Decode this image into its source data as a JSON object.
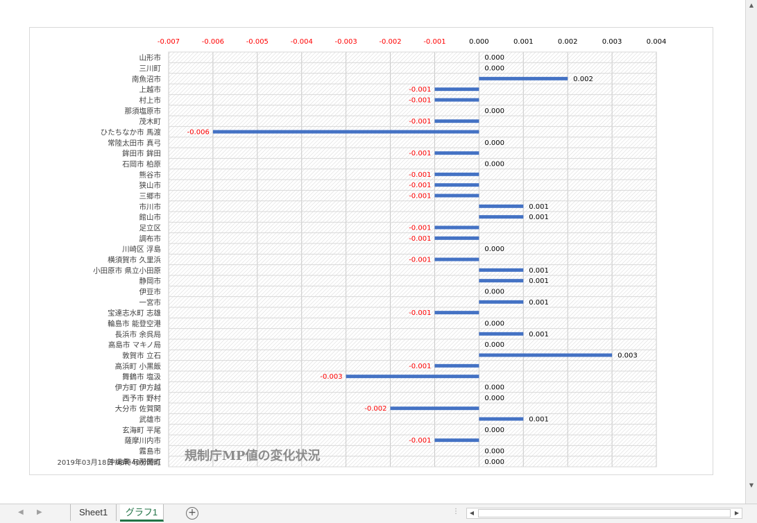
{
  "chart_data": {
    "type": "bar",
    "orientation": "horizontal",
    "title": "規制庁MP値の変化状況",
    "timestamp": "2019年03月18日 08時40分時点",
    "xlim": [
      -0.007,
      0.004
    ],
    "x_ticks": [
      "-0.007",
      "-0.006",
      "-0.005",
      "-0.004",
      "-0.003",
      "-0.002",
      "-0.001",
      "0.000",
      "0.001",
      "0.002",
      "0.003",
      "0.004"
    ],
    "negative_label_color": "#ff0000",
    "positive_label_color": "#000000",
    "bar_color": "#4472c4",
    "grid": true,
    "categories": [
      "山形市",
      "三川町",
      "南魚沼市",
      "上越市",
      "村上市",
      "那須塩原市",
      "茂木町",
      "ひたちなか市 馬渡",
      "常陸太田市 真弓",
      "鉾田市 鉾田",
      "石岡市 柏原",
      "熊谷市",
      "狭山市",
      "三郷市",
      "市川市",
      "館山市",
      "足立区",
      "調布市",
      "川崎区 浮島",
      "横須賀市 久里浜",
      "小田原市 県立小田原",
      "静岡市",
      "伊豆市",
      "一宮市",
      "宝達志水町 志雄",
      "輪島市 能登空港",
      "長浜市 余呉局",
      "高島市 マキノ局",
      "敦賀市 立石",
      "高浜町 小黒飯",
      "舞鶴市 塩汲",
      "伊方町 伊方越",
      "西予市 野村",
      "大分市 佐賀関",
      "武雄市",
      "玄海町 平尾",
      "薩摩川内市",
      "霧島市",
      "沖縄県 与那国町"
    ],
    "values": [
      0.0,
      0.0,
      0.002,
      -0.001,
      -0.001,
      0.0,
      -0.001,
      -0.006,
      0.0,
      -0.001,
      0.0,
      -0.001,
      -0.001,
      -0.001,
      0.001,
      0.001,
      -0.001,
      -0.001,
      0.0,
      -0.001,
      0.001,
      0.001,
      0.0,
      0.001,
      -0.001,
      0.0,
      0.001,
      0.0,
      0.003,
      -0.001,
      -0.003,
      0.0,
      0.0,
      -0.002,
      0.001,
      0.0,
      -0.001,
      0.0,
      0.0
    ],
    "value_labels": [
      "0.000",
      "0.000",
      "0.002",
      "-0.001",
      "-0.001",
      "0.000",
      "-0.001",
      "-0.006",
      "0.000",
      "-0.001",
      "0.000",
      "-0.001",
      "-0.001",
      "-0.001",
      "0.001",
      "0.001",
      "-0.001",
      "-0.001",
      "0.000",
      "-0.001",
      "0.001",
      "0.001",
      "0.000",
      "0.001",
      "-0.001",
      "0.000",
      "0.001",
      "0.000",
      "0.003",
      "-0.001",
      "-0.003",
      "0.000",
      "0.000",
      "-0.002",
      "0.001",
      "0.000",
      "-0.001",
      "0.000",
      "0.000"
    ]
  },
  "tabs": {
    "sheet1": "Sheet1",
    "graph1": "グラフ1",
    "add_icon": "+"
  },
  "nav": {
    "prev": "◀",
    "next": "▶",
    "scroll_left": "◀",
    "scroll_right": "▶",
    "scroll_up": "▲",
    "scroll_down": "▼",
    "dots": "⋮"
  }
}
